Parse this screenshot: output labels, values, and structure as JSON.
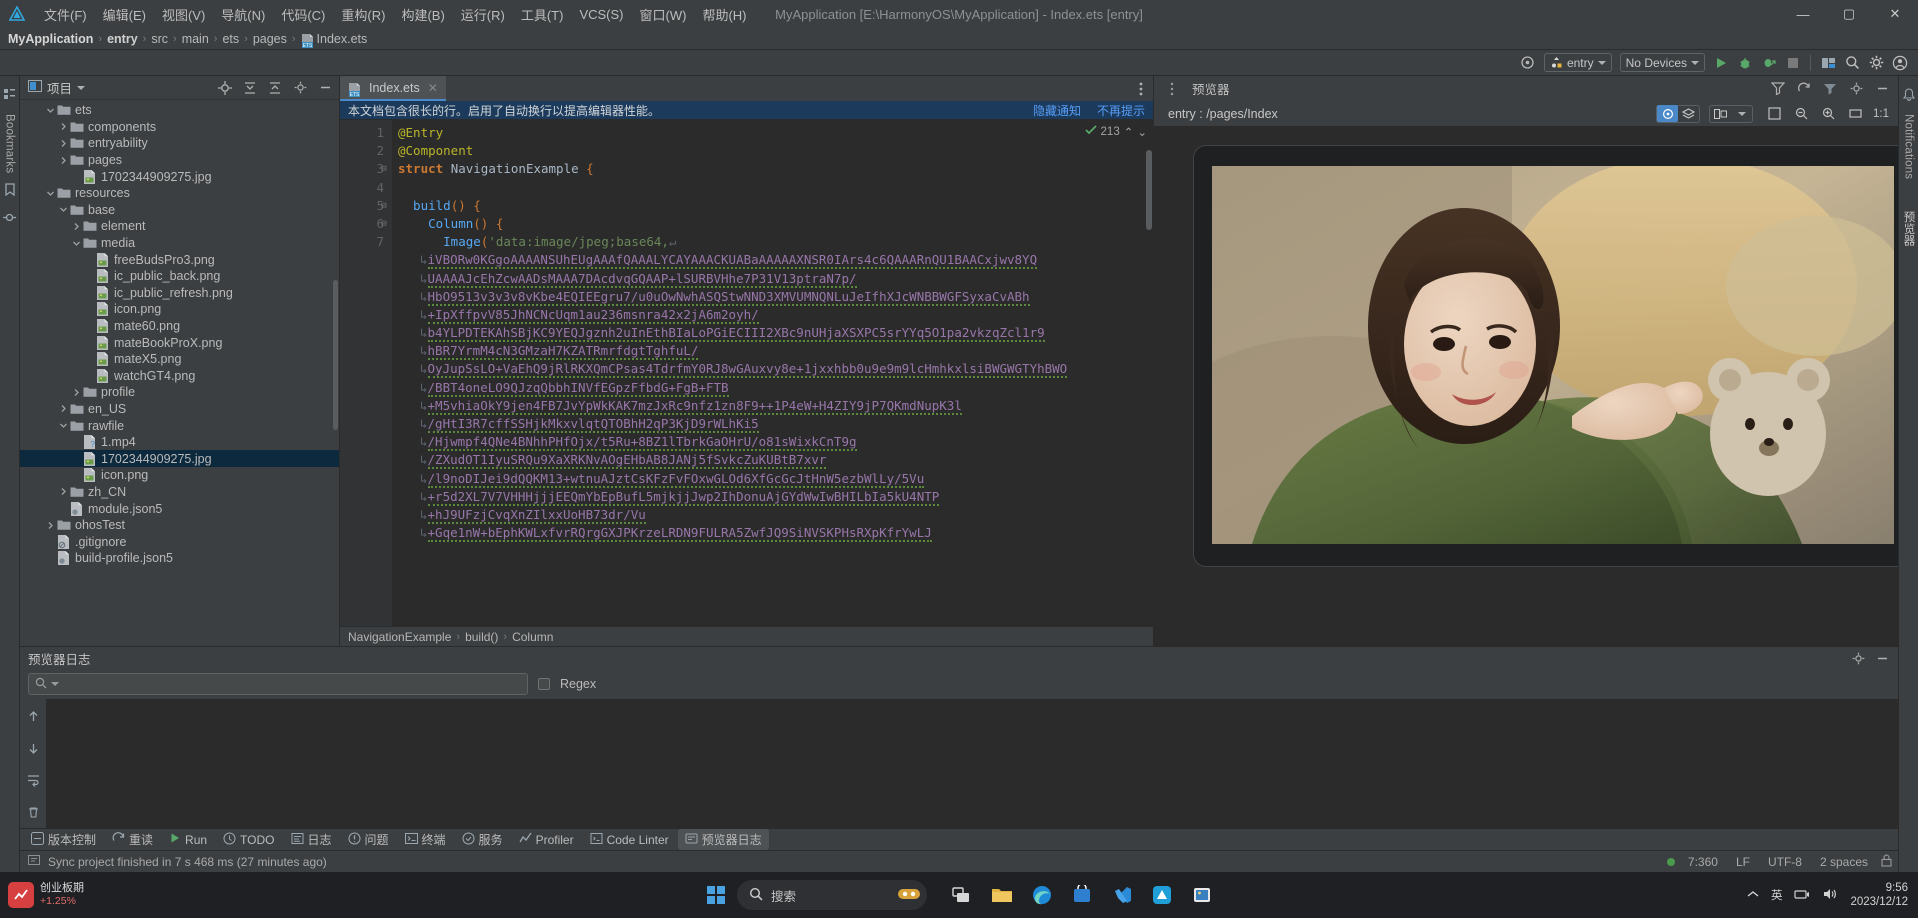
{
  "menubar": {
    "logo_icon": "deveco-logo-icon",
    "items": [
      "文件(F)",
      "编辑(E)",
      "视图(V)",
      "导航(N)",
      "代码(C)",
      "重构(R)",
      "构建(B)",
      "运行(R)",
      "工具(T)",
      "VCS(S)",
      "窗口(W)",
      "帮助(H)"
    ],
    "window_title": "MyApplication [E:\\HarmonyOS\\MyApplication] - Index.ets [entry]",
    "controls": {
      "minimize": "—",
      "maximize": "▢",
      "close": "✕"
    }
  },
  "breadcrumb": {
    "items": [
      "MyApplication",
      "entry",
      "src",
      "main",
      "ets",
      "pages",
      "Index.ets"
    ],
    "separator": "›"
  },
  "toolbar": {
    "target_icon": "target-icon",
    "module_selector": "entry",
    "device_selector": "No Devices",
    "run_icon": "run-icon",
    "debug_icon": "debug-icon",
    "profile_icon": "attach-debugger-icon",
    "stop_icon": "stop-icon",
    "layout_icon": "layout-inspector-icon",
    "search_icon": "search-everywhere-icon",
    "settings_icon": "settings-gear-icon",
    "account_icon": "user-account-icon"
  },
  "left_rail": {
    "bookmarks_label": "Bookmarks",
    "structure_icon": "structure-icon"
  },
  "right_rail": {
    "notifications_label": "Notifications",
    "preview_label": "预览器"
  },
  "project_pane": {
    "title": "项目",
    "dropdown_icon": "chevron-down-icon",
    "locate_icon": "scroll-from-source-icon",
    "expand_icon": "expand-all-icon",
    "collapse_icon": "collapse-all-icon",
    "settings_icon": "options-gear-icon",
    "hide_icon": "hide-panel-icon",
    "tree": [
      {
        "label": "ets",
        "indent": 3,
        "type": "folder",
        "twisty": "v"
      },
      {
        "label": "components",
        "indent": 4,
        "type": "folder",
        "twisty": ">"
      },
      {
        "label": "entryability",
        "indent": 4,
        "type": "folder",
        "twisty": ">"
      },
      {
        "label": "pages",
        "indent": 4,
        "type": "folder",
        "twisty": ">"
      },
      {
        "label": "1702344909275.jpg",
        "indent": 5,
        "type": "image",
        "twisty": ""
      },
      {
        "label": "resources",
        "indent": 3,
        "type": "folder",
        "twisty": "v"
      },
      {
        "label": "base",
        "indent": 4,
        "type": "folder",
        "twisty": "v"
      },
      {
        "label": "element",
        "indent": 5,
        "type": "folder",
        "twisty": ">"
      },
      {
        "label": "media",
        "indent": 5,
        "type": "folder",
        "twisty": "v"
      },
      {
        "label": "freeBudsPro3.png",
        "indent": 6,
        "type": "image",
        "twisty": ""
      },
      {
        "label": "ic_public_back.png",
        "indent": 6,
        "type": "image",
        "twisty": ""
      },
      {
        "label": "ic_public_refresh.png",
        "indent": 6,
        "type": "image",
        "twisty": ""
      },
      {
        "label": "icon.png",
        "indent": 6,
        "type": "image",
        "twisty": ""
      },
      {
        "label": "mate60.png",
        "indent": 6,
        "type": "image",
        "twisty": ""
      },
      {
        "label": "mateBookProX.png",
        "indent": 6,
        "type": "image",
        "twisty": ""
      },
      {
        "label": "mateX5.png",
        "indent": 6,
        "type": "image",
        "twisty": ""
      },
      {
        "label": "watchGT4.png",
        "indent": 6,
        "type": "image",
        "twisty": ""
      },
      {
        "label": "profile",
        "indent": 5,
        "type": "folder",
        "twisty": ">"
      },
      {
        "label": "en_US",
        "indent": 4,
        "type": "folder",
        "twisty": ">"
      },
      {
        "label": "rawfile",
        "indent": 4,
        "type": "folder",
        "twisty": "v"
      },
      {
        "label": "1.mp4",
        "indent": 5,
        "type": "video",
        "twisty": ""
      },
      {
        "label": "1702344909275.jpg",
        "indent": 5,
        "type": "image",
        "twisty": "",
        "selected": true
      },
      {
        "label": "icon.png",
        "indent": 5,
        "type": "image",
        "twisty": ""
      },
      {
        "label": "zh_CN",
        "indent": 4,
        "type": "folder",
        "twisty": ">"
      },
      {
        "label": "module.json5",
        "indent": 4,
        "type": "json",
        "twisty": ""
      },
      {
        "label": "ohosTest",
        "indent": 3,
        "type": "folder",
        "twisty": ">"
      },
      {
        "label": ".gitignore",
        "indent": 3,
        "type": "gitignore",
        "twisty": ""
      },
      {
        "label": "build-profile.json5",
        "indent": 3,
        "type": "json",
        "twisty": ""
      }
    ]
  },
  "editor": {
    "tab": {
      "label": "Index.ets",
      "icon": "ets-file-icon",
      "close": "✕"
    },
    "options_icon": "editor-options-icon",
    "notification": {
      "message": "本文档包含很长的行。启用了自动换行以提高编辑器性能。",
      "action_hide": "隐藏通知",
      "action_dismiss": "不再提示"
    },
    "inspection": {
      "count": "213",
      "up": "⌃",
      "down": "⌄",
      "icon": "inspection-check-icon"
    },
    "line_numbers": [
      "1",
      "2",
      "3",
      "4",
      "5",
      "6",
      "7"
    ],
    "lines": [
      {
        "n": "1",
        "parts": [
          {
            "t": "@Entry",
            "c": "dec"
          }
        ]
      },
      {
        "n": "2",
        "parts": [
          {
            "t": "@Component",
            "c": "dec"
          }
        ]
      },
      {
        "n": "3",
        "parts": [
          {
            "t": "struct ",
            "c": "kw"
          },
          {
            "t": "NavigationExample ",
            "c": "typ"
          },
          {
            "t": "{",
            "c": "br"
          }
        ]
      },
      {
        "n": "4",
        "parts": []
      },
      {
        "n": "5",
        "parts": [
          {
            "t": "  build",
            "c": "fn"
          },
          {
            "t": "() ",
            "c": "br"
          },
          {
            "t": "{",
            "c": "br"
          }
        ]
      },
      {
        "n": "6",
        "parts": [
          {
            "t": "    Column",
            "c": "fn"
          },
          {
            "t": "() ",
            "c": "br"
          },
          {
            "t": "{",
            "c": "br"
          }
        ]
      },
      {
        "n": "7",
        "parts": [
          {
            "t": "      Image",
            "c": "fn"
          },
          {
            "t": "(",
            "c": "br"
          },
          {
            "t": "'data:image/jpeg;base64,",
            "c": "str"
          },
          {
            "t": "↵",
            "c": "wrapmark"
          }
        ]
      }
    ],
    "wrapped_b64": [
      "iVBORw0KGgoAAAANSUhEUgAAAfQAAALYCAYAAACKUABaAAAAAXNSR0IArs4c6QAAARnQU1BAACxjwv8YQ",
      "UAAAAJcEhZcwAADsMAAA7DAcdvqGQAAP+lSURBVHhe7P31V13ptraN7p/",
      "HbO9513v3v3v8vKbe4EQIEEgru7/u0uOwNwhASQStwNND3XMVUMNQNLuJeIfhXJcWNBBWGFSyxaCvABh",
      "+IpXffpvV85JhNCNcUqm1au236msnra42x2jA6m2oyh/",
      "b4YLPDTEKAhSBjKC9YEQJgznh2uInEthBIaLoPGiECIII2XBc9nUHjaXSXPC5srYYq5O1pa2vkzqZcl1r9",
      "hBR7YrmM4cN3GMzaH7KZATRmrfdgtTghfuL/",
      "OyJupSsLO+VaEhQ9jRlRKXQmCPsas4TdrfmY0RJ8wGAuxvy8e+1jxxhbb0u9e9m9lcHmhkxlsiBWGWGTYhBWO",
      "/BBT4oneLO9QJzqQbbhINVfEGpzFfbdG+FgB+FTB",
      "+M5vhiaOkY9jen4FB7JvYpWkKAK7mzJxRc9nfz1zn8F9++1P4eW+H4ZIY9jP7QKmdNupK3l",
      "/gHtI3R7cffSSHjkMkxvlqtQTOBhH2qP3KjD9rWLhKi5",
      "/Hjwmpf4QNe4BNhhPHfOjx/t5Ru+8BZ1lTbrkGaOHrU/o81sWixkCnT9g",
      "/ZXudOT1IyuSRQu9XaXRKNvAOgEHbAB8JANj5fSvkcZuKUBtB7xvr",
      "/l9noDIJei9dQQKM13+wtnuAJztCsKFzFvFOxwGLOd6XfGcGcJtHnW5ezbWlLy/5Vu",
      "+r5d2XL7V7VHHHjjjEEQmYbEpBufL5mjkjjJwp2IhDonuAjGYdWwIwBHILbIa5kU4NTP",
      "+hJ9UFzjCvqXnZIlxxUoHB73dr/Vu",
      "+Gqe1nW+bEphKWLxfvrRQrgGXJPKrzeLRDN9FULRA5ZwfJQ9SiNVSKPHsRXpKfrYwLJ"
    ],
    "breadcrumb_bar": [
      "NavigationExample",
      "build()",
      "Column"
    ]
  },
  "preview": {
    "title": "预览器",
    "options_icon": "preview-options-icon",
    "path": "entry : /pages/Index",
    "toolbar_icons": [
      "inspector-icon",
      "layers-icon",
      "multi-device-icon",
      "chevron-down-icon",
      "fit-icon",
      "zoom-out-icon",
      "zoom-in-icon",
      "ratio-icon"
    ],
    "zoom_level": "1:1",
    "settings_icon": "settings-gear-icon",
    "hide_icon": "hide-panel-icon",
    "device_frame": "phone-frame"
  },
  "log_pane": {
    "title": "预览器日志",
    "settings_icon": "settings-gear-icon",
    "hide_icon": "hide-panel-icon",
    "search_placeholder": "",
    "search_icon": "search-icon",
    "regex_label": "Regex",
    "scroll_up_icon": "scroll-up-icon",
    "scroll_down_icon": "scroll-down-icon",
    "wrap_icon": "soft-wrap-icon",
    "clear_icon": "clear-all-icon",
    "content": ""
  },
  "tool_strip": {
    "items": [
      {
        "label": "版本控制",
        "icon": "version-control-icon"
      },
      {
        "label": "重读",
        "icon": "refresh-icon"
      },
      {
        "label": "Run",
        "icon": "run-icon"
      },
      {
        "label": "TODO",
        "icon": "todo-icon"
      },
      {
        "label": "日志",
        "icon": "log-icon"
      },
      {
        "label": "问题",
        "icon": "problems-icon"
      },
      {
        "label": "终端",
        "icon": "terminal-icon"
      },
      {
        "label": "服务",
        "icon": "services-icon"
      },
      {
        "label": "Profiler",
        "icon": "profiler-icon"
      },
      {
        "label": "Code Linter",
        "icon": "code-linter-icon"
      },
      {
        "label": "预览器日志",
        "icon": "preview-log-icon",
        "active": true
      }
    ]
  },
  "statusbar": {
    "message": "Sync project finished in 7 s 468 ms (27 minutes ago)",
    "status_icon": "event-log-icon",
    "caret_position": "7:360",
    "line_separator": "LF",
    "encoding": "UTF-8",
    "indent": "2 spaces",
    "lock_icon": "lock-icon",
    "ok_icon": "green-status-icon"
  },
  "taskbar": {
    "promo": {
      "title": "创业板期",
      "sub": "+1.25%",
      "icon": "stock-app-icon"
    },
    "start_icon": "windows-start-icon",
    "search_placeholder": "搜索",
    "search_icon": "search-icon",
    "apps": [
      {
        "name": "task-view-icon"
      },
      {
        "name": "file-explorer-icon"
      },
      {
        "name": "edge-browser-icon"
      },
      {
        "name": "store-icon"
      },
      {
        "name": "vscode-icon"
      },
      {
        "name": "deveco-studio-icon"
      },
      {
        "name": "photos-app-icon"
      }
    ],
    "tray": {
      "expand_icon": "chevron-up-icon",
      "ime": "英",
      "network_icon": "network-icon",
      "volume_icon": "volume-icon"
    },
    "clock": {
      "time": "9:56",
      "date": "2023/12/12"
    }
  },
  "colors": {
    "accent": "#4a88c7",
    "panel": "#3c3f41",
    "editor_bg": "#2b2b2b",
    "selection": "#0d293e",
    "notif_bg": "#1b3a5c",
    "green": "#4c9a4c",
    "orange": "#cc7832"
  }
}
